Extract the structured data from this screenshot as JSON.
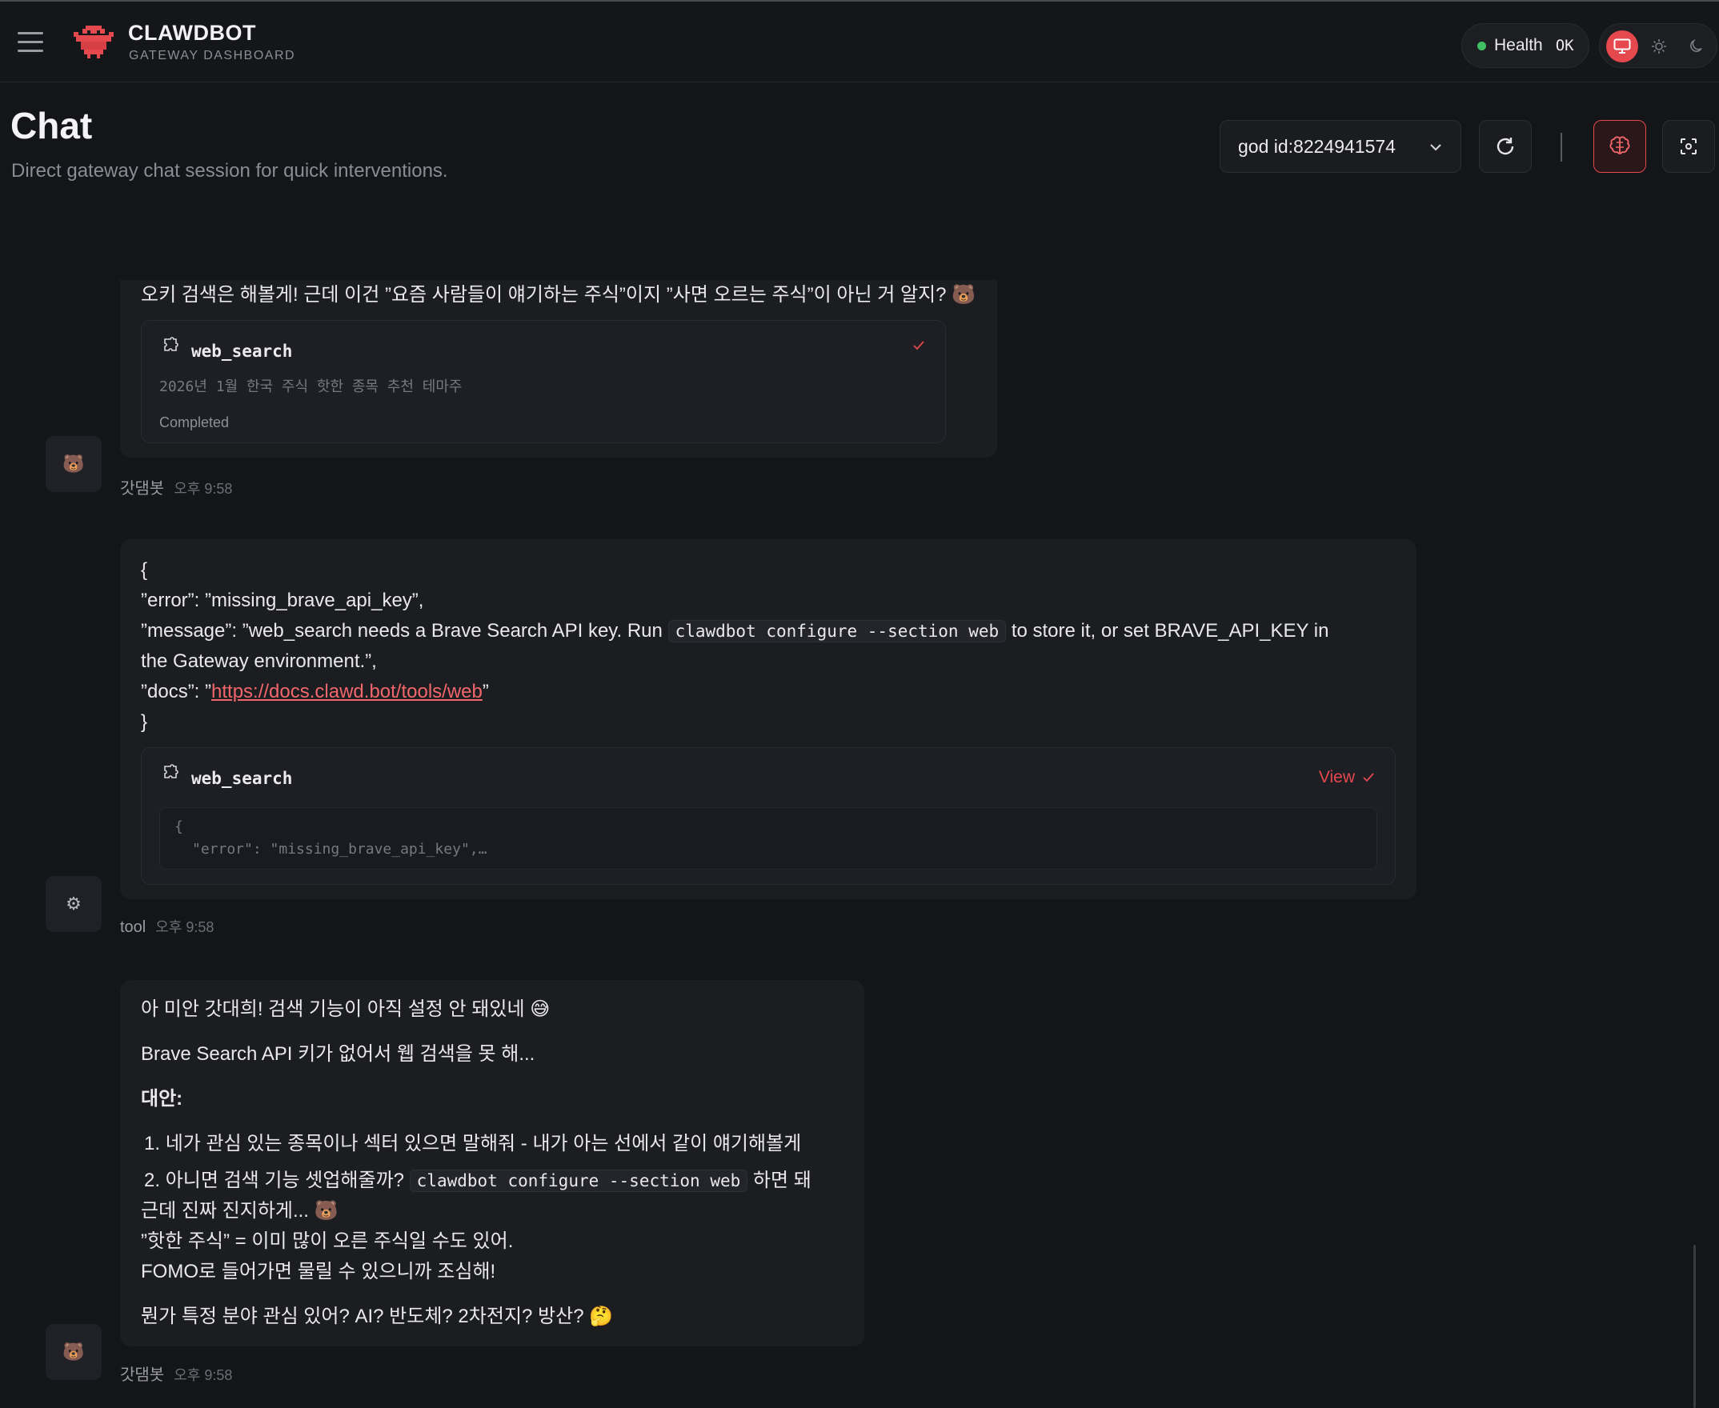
{
  "app": {
    "title": "CLAWDBOT",
    "subtitle": "GATEWAY DASHBOARD"
  },
  "health": {
    "label": "Health",
    "status": "OK"
  },
  "page": {
    "title": "Chat",
    "subtitle": "Direct gateway chat session for quick interventions."
  },
  "session": {
    "selected": "god id:8224941574"
  },
  "messages": [
    {
      "text": "오키 검색은 해볼게! 근데 이건 ”요즘 사람들이 얘기하는 주식”이지 ”사면 오르는 주식”이 아닌 거 알지? 🐻",
      "tool": {
        "name": "web_search",
        "query": "2026년 1월 한국 주식 핫한 종목 추천 테마주",
        "status": "Completed"
      },
      "avatar": "🐻",
      "sender": "갓댐봇",
      "time": "오후 9:58"
    },
    {
      "lines": {
        "open": "{",
        "error": "”error”: ”missing_brave_api_key”,",
        "msg_a": "”message”: ”web_search needs a Brave Search API key. Run",
        "msg_code": "clawdbot configure --section web",
        "msg_b": "to store it, or set BRAVE_API_KEY in",
        "msg_c": "the Gateway environment.”,",
        "docs_a": "”docs”: ”",
        "docs_link": "https://docs.clawd.bot/tools/web",
        "docs_b": "”",
        "close": "}"
      },
      "tool": {
        "name": "web_search",
        "view_label": "View",
        "preview_1": "{",
        "preview_2": "\"error\": \"missing_brave_api_key\",…"
      },
      "avatar": "⚙",
      "sender": "tool",
      "time": "오후 9:58"
    },
    {
      "p1": "아 미안 갓대희! 검색 기능이 아직 설정 안 돼있네 😅",
      "p2": "Brave Search API 키가 없어서 웹 검색을 못 해...",
      "heading": "대안:",
      "item1": "네가 관심 있는 종목이나 섹터 있으면 말해줘 - 내가 아는 선에서 같이 얘기해볼게",
      "item2_a": "아니면 검색 기능 셋업해줄까?",
      "item2_code": "clawdbot configure --section web",
      "item2_b": "하면 돼",
      "l1": "근데 진짜 진지하게... 🐻",
      "l2": "”핫한 주식” = 이미 많이 오른 주식일 수도 있어.",
      "l3": "FOMO로 들어가면 물릴 수 있으니까 조심해!",
      "p_last": "뭔가 특정 분야 관심 있어? AI? 반도체? 2차전지? 방산? 🤔",
      "avatar": "🐻",
      "sender": "갓댐봇",
      "time": "오후 9:58"
    }
  ]
}
